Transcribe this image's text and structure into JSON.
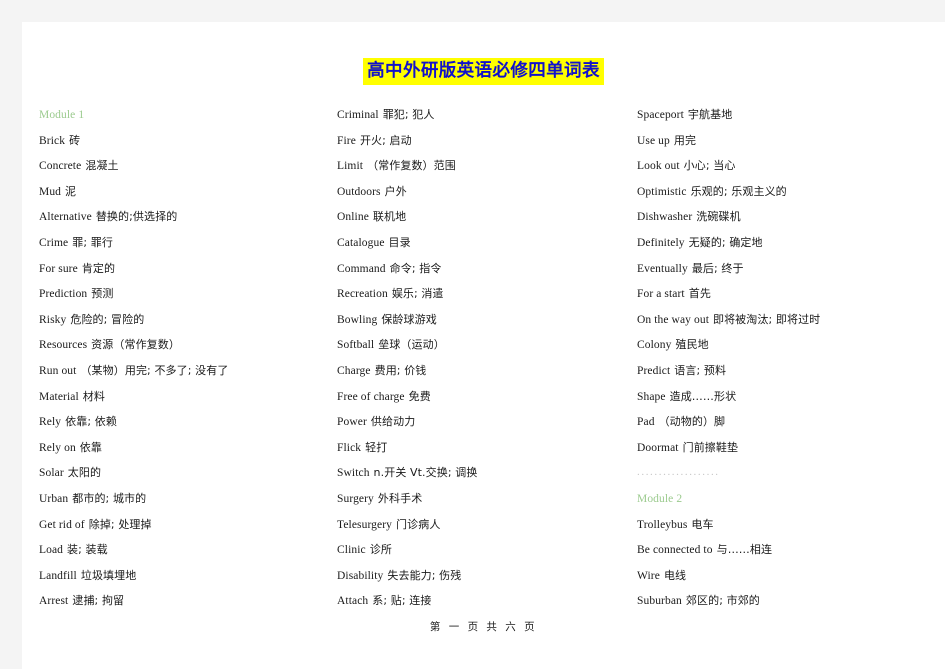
{
  "document": {
    "title": "高中外研版英语必修四单词表",
    "title_color": "#1111cc",
    "highlight_color": "#ffff00",
    "module_color": "#9ccb8f",
    "footer": "第 一 页 共 六 页"
  },
  "columns": [
    {
      "id": "column-1",
      "entries": [
        {
          "type": "module",
          "en": "Module  1",
          "zh": ""
        },
        {
          "type": "word",
          "en": "Brick",
          "zh": "砖"
        },
        {
          "type": "word",
          "en": "Concrete",
          "zh": "混凝土"
        },
        {
          "type": "word",
          "en": "Mud",
          "zh": "泥"
        },
        {
          "type": "word",
          "en": "Alternative",
          "zh": "替换的;供选择的"
        },
        {
          "type": "word",
          "en": "Crime",
          "zh": "罪; 罪行"
        },
        {
          "type": "word",
          "en": "For sure",
          "zh": "肯定的"
        },
        {
          "type": "word",
          "en": "Prediction",
          "zh": "预测"
        },
        {
          "type": "word",
          "en": "Risky",
          "zh": "危险的; 冒险的"
        },
        {
          "type": "word",
          "en": "Resources",
          "zh": "资源（常作复数）"
        },
        {
          "type": "word",
          "en": "Run out",
          "zh": "（某物）用完; 不多了; 没有了"
        },
        {
          "type": "word",
          "en": "Material",
          "zh": "材料"
        },
        {
          "type": "word",
          "en": "Rely",
          "zh": "依靠; 依赖"
        },
        {
          "type": "word",
          "en": "Rely on",
          "zh": "依靠"
        },
        {
          "type": "word",
          "en": "Solar",
          "zh": "太阳的"
        },
        {
          "type": "word",
          "en": "Urban",
          "zh": "都市的; 城市的"
        },
        {
          "type": "word",
          "en": "Get rid of",
          "zh": "除掉; 处理掉"
        },
        {
          "type": "word",
          "en": "Load",
          "zh": "装; 装载"
        },
        {
          "type": "word",
          "en": "Landfill",
          "zh": "垃圾填埋地"
        },
        {
          "type": "word",
          "en": "Arrest",
          "zh": "逮捕; 拘留"
        }
      ]
    },
    {
      "id": "column-2",
      "entries": [
        {
          "type": "word",
          "en": "Criminal",
          "zh": "罪犯; 犯人"
        },
        {
          "type": "word",
          "en": "Fire",
          "zh": "开火; 启动"
        },
        {
          "type": "word",
          "en": "Limit",
          "zh": "（常作复数）范围"
        },
        {
          "type": "word",
          "en": "Outdoors",
          "zh": "户外"
        },
        {
          "type": "word",
          "en": "Online",
          "zh": "联机地"
        },
        {
          "type": "word",
          "en": "Catalogue",
          "zh": "目录"
        },
        {
          "type": "word",
          "en": "Command",
          "zh": "命令; 指令"
        },
        {
          "type": "word",
          "en": "Recreation",
          "zh": "娱乐; 消遣"
        },
        {
          "type": "word",
          "en": "Bowling",
          "zh": "保龄球游戏"
        },
        {
          "type": "word",
          "en": "Softball",
          "zh": "垒球（运动）"
        },
        {
          "type": "word",
          "en": "Charge",
          "zh": "费用; 价钱"
        },
        {
          "type": "word",
          "en": "Free of charge",
          "zh": "免费"
        },
        {
          "type": "word",
          "en": "Power",
          "zh": "供给动力"
        },
        {
          "type": "word",
          "en": "Flick",
          "zh": "轻打"
        },
        {
          "type": "word",
          "en": "Switch",
          "zh": "n.开关   Vt.交换; 调换"
        },
        {
          "type": "word",
          "en": "Surgery",
          "zh": "外科手术"
        },
        {
          "type": "word",
          "en": "Telesurgery",
          "zh": "门诊病人"
        },
        {
          "type": "word",
          "en": "Clinic",
          "zh": "诊所"
        },
        {
          "type": "word",
          "en": "Disability",
          "zh": "失去能力; 伤残"
        },
        {
          "type": "word",
          "en": "Attach",
          "zh": "系; 贴; 连接"
        }
      ]
    },
    {
      "id": "column-3",
      "entries": [
        {
          "type": "word",
          "en": "Spaceport",
          "zh": "宇航基地"
        },
        {
          "type": "word",
          "en": "Use up",
          "zh": "用完"
        },
        {
          "type": "word",
          "en": "Look out",
          "zh": "小心; 当心"
        },
        {
          "type": "word",
          "en": "Optimistic",
          "zh": "乐观的; 乐观主义的"
        },
        {
          "type": "word",
          "en": "Dishwasher",
          "zh": "洗碗碟机"
        },
        {
          "type": "word",
          "en": "Definitely",
          "zh": "无疑的; 确定地"
        },
        {
          "type": "word",
          "en": "Eventually",
          "zh": "最后; 终于"
        },
        {
          "type": "word",
          "en": "For a start",
          "zh": "首先"
        },
        {
          "type": "word",
          "en": "On the way out",
          "zh": "即将被淘汰; 即将过时"
        },
        {
          "type": "word",
          "en": "Colony",
          "zh": "殖民地"
        },
        {
          "type": "word",
          "en": "Predict",
          "zh": "语言; 预料"
        },
        {
          "type": "word",
          "en": "Shape",
          "zh": "造成……形状"
        },
        {
          "type": "word",
          "en": "Pad",
          "zh": "（动物的）脚"
        },
        {
          "type": "word",
          "en": "Doormat",
          "zh": "门前擦鞋垫"
        },
        {
          "type": "dots",
          "en": "...................",
          "zh": ""
        },
        {
          "type": "module",
          "en": "Module  2",
          "zh": ""
        },
        {
          "type": "word",
          "en": "Trolleybus",
          "zh": "电车"
        },
        {
          "type": "word",
          "en": "Be connected to",
          "zh": "与……相连"
        },
        {
          "type": "word",
          "en": "Wire",
          "zh": "电线"
        },
        {
          "type": "word",
          "en": "Suburban",
          "zh": "郊区的; 市郊的"
        }
      ]
    }
  ]
}
